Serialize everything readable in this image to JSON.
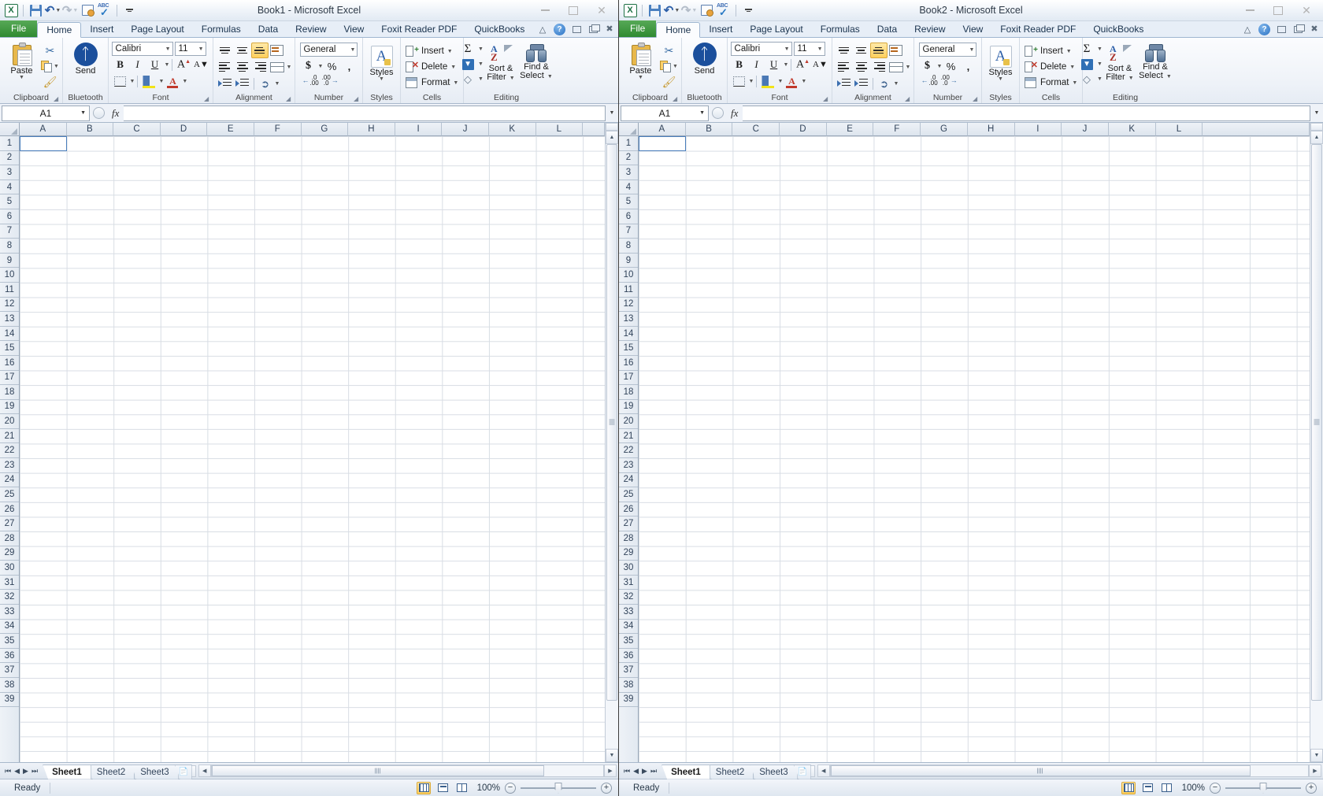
{
  "app": {
    "name": "Microsoft Excel"
  },
  "windows": [
    {
      "id": "window-1",
      "title": "Book1  -  Microsoft Excel",
      "quick_access": [
        {
          "name": "excel-logo-icon",
          "label": "X"
        },
        {
          "name": "save-icon",
          "label": "Save"
        },
        {
          "name": "undo-icon",
          "label": "Undo"
        },
        {
          "name": "redo-icon",
          "label": "Redo"
        },
        {
          "name": "print-preview-icon",
          "label": "Print Preview and Print"
        },
        {
          "name": "spelling-icon",
          "label": "Spelling"
        },
        {
          "name": "customize-qat-icon",
          "label": "Customize Quick Access Toolbar"
        }
      ],
      "window_controls": [
        {
          "name": "minimize-button",
          "label": "Minimize"
        },
        {
          "name": "maximize-button",
          "label": "Maximize"
        },
        {
          "name": "close-button",
          "label": "Close"
        }
      ],
      "tabs": [
        {
          "label": "File",
          "active": false,
          "file": true
        },
        {
          "label": "Home",
          "active": true
        },
        {
          "label": "Insert",
          "active": false
        },
        {
          "label": "Page Layout",
          "active": false
        },
        {
          "label": "Formulas",
          "active": false
        },
        {
          "label": "Data",
          "active": false
        },
        {
          "label": "Review",
          "active": false
        },
        {
          "label": "View",
          "active": false
        },
        {
          "label": "Foxit Reader PDF",
          "active": false
        },
        {
          "label": "QuickBooks",
          "active": false
        }
      ],
      "namebox": {
        "value": "A1"
      },
      "formula": {
        "value": ""
      },
      "sheet_tabs": [
        {
          "label": "Sheet1",
          "active": true
        },
        {
          "label": "Sheet2",
          "active": false
        },
        {
          "label": "Sheet3",
          "active": false
        }
      ],
      "status": {
        "text": "Ready",
        "zoom": "100%"
      }
    },
    {
      "id": "window-2",
      "title": "Book2  -  Microsoft Excel",
      "quick_access": [
        {
          "name": "excel-logo-icon",
          "label": "X"
        },
        {
          "name": "save-icon",
          "label": "Save"
        },
        {
          "name": "undo-icon",
          "label": "Undo"
        },
        {
          "name": "redo-icon",
          "label": "Redo"
        },
        {
          "name": "print-preview-icon",
          "label": "Print Preview and Print"
        },
        {
          "name": "spelling-icon",
          "label": "Spelling"
        },
        {
          "name": "customize-qat-icon",
          "label": "Customize Quick Access Toolbar"
        }
      ],
      "window_controls": [
        {
          "name": "minimize-button",
          "label": "Minimize"
        },
        {
          "name": "maximize-button",
          "label": "Maximize"
        },
        {
          "name": "close-button",
          "label": "Close"
        }
      ],
      "tabs": [
        {
          "label": "File",
          "active": false,
          "file": true
        },
        {
          "label": "Home",
          "active": true
        },
        {
          "label": "Insert",
          "active": false
        },
        {
          "label": "Page Layout",
          "active": false
        },
        {
          "label": "Formulas",
          "active": false
        },
        {
          "label": "Data",
          "active": false
        },
        {
          "label": "Review",
          "active": false
        },
        {
          "label": "View",
          "active": false
        },
        {
          "label": "Foxit Reader PDF",
          "active": false
        },
        {
          "label": "QuickBooks",
          "active": false
        }
      ],
      "namebox": {
        "value": "A1"
      },
      "formula": {
        "value": ""
      },
      "sheet_tabs": [
        {
          "label": "Sheet1",
          "active": true
        },
        {
          "label": "Sheet2",
          "active": false
        },
        {
          "label": "Sheet3",
          "active": false
        }
      ],
      "status": {
        "text": "Ready",
        "zoom": "100%"
      }
    }
  ],
  "ribbon": {
    "groups": [
      {
        "name": "clipboard",
        "label": "Clipboard",
        "has_dialog": true,
        "items": [
          {
            "label": "Paste",
            "dropdown": true
          },
          {
            "label": "Cut"
          },
          {
            "label": "Copy"
          },
          {
            "label": "Format Painter"
          }
        ]
      },
      {
        "name": "bluetooth",
        "label": "Bluetooth",
        "has_dialog": false,
        "items": [
          {
            "label": "Send"
          }
        ]
      },
      {
        "name": "font",
        "label": "Font",
        "has_dialog": true,
        "font_name": "Calibri",
        "font_size": "11",
        "items": [
          {
            "label": "Bold"
          },
          {
            "label": "Italic"
          },
          {
            "label": "Underline"
          },
          {
            "label": "Increase Font Size"
          },
          {
            "label": "Decrease Font Size"
          },
          {
            "label": "Borders"
          },
          {
            "label": "Fill Color"
          },
          {
            "label": "Font Color"
          }
        ]
      },
      {
        "name": "alignment",
        "label": "Alignment",
        "has_dialog": true,
        "items": [
          {
            "label": "Top Align"
          },
          {
            "label": "Middle Align"
          },
          {
            "label": "Bottom Align"
          },
          {
            "label": "Wrap Text"
          },
          {
            "label": "Align Text Left"
          },
          {
            "label": "Center"
          },
          {
            "label": "Align Text Right"
          },
          {
            "label": "Merge & Center"
          },
          {
            "label": "Decrease Indent"
          },
          {
            "label": "Increase Indent"
          },
          {
            "label": "Orientation"
          }
        ]
      },
      {
        "name": "number",
        "label": "Number",
        "has_dialog": true,
        "format": "General",
        "items": [
          {
            "label": "Accounting Number Format"
          },
          {
            "label": "Percent Style"
          },
          {
            "label": "Comma Style"
          },
          {
            "label": "Increase Decimal"
          },
          {
            "label": "Decrease Decimal"
          }
        ]
      },
      {
        "name": "styles",
        "label": "Styles",
        "has_dialog": false,
        "items": [
          {
            "label": "Styles",
            "dropdown": true
          }
        ]
      },
      {
        "name": "cells",
        "label": "Cells",
        "has_dialog": false,
        "items": [
          {
            "label": "Insert",
            "dropdown": true
          },
          {
            "label": "Delete",
            "dropdown": true
          },
          {
            "label": "Format",
            "dropdown": true
          }
        ]
      },
      {
        "name": "editing",
        "label": "Editing",
        "has_dialog": false,
        "items": [
          {
            "label": "AutoSum"
          },
          {
            "label": "Fill"
          },
          {
            "label": "Clear"
          },
          {
            "label": "Sort &\nFilter",
            "dropdown": true
          },
          {
            "label": "Find &\nSelect",
            "dropdown": true
          }
        ]
      }
    ],
    "editing_buttons": [
      {
        "line1": "Sort &",
        "line2": "Filter"
      },
      {
        "line1": "Find &",
        "line2": "Select"
      }
    ],
    "cells_buttons": [
      "Insert",
      "Delete",
      "Format"
    ]
  },
  "grid": {
    "columns": [
      "A",
      "B",
      "C",
      "D",
      "E",
      "F",
      "G",
      "H",
      "I",
      "J",
      "K",
      "L"
    ],
    "rows": [
      1,
      2,
      3,
      4,
      5,
      6,
      7,
      8,
      9,
      10,
      11,
      12,
      13,
      14,
      15,
      16,
      17,
      18,
      19,
      20,
      21,
      22,
      23,
      24,
      25,
      26,
      27,
      28,
      29,
      30,
      31,
      32,
      33,
      34,
      35,
      36,
      37,
      38,
      39
    ],
    "selected_cell": "A1"
  },
  "colors": {
    "file_tab_green": "#2f8a31",
    "selection_blue": "#4a7ebb",
    "highlight_gold": "#ffcf5c",
    "bluetooth_blue": "#1b4f9c"
  }
}
